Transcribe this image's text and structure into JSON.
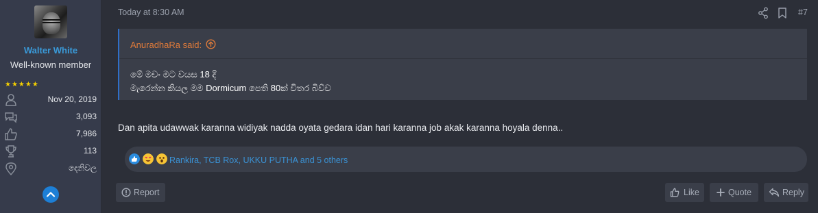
{
  "author": {
    "name": "Walter White",
    "title": "Well-known member",
    "stars": "★★★★★",
    "joined": "Nov 20, 2019",
    "messages": "3,093",
    "reaction_score": "7,986",
    "points": "113",
    "location": "දෙනිවල"
  },
  "post": {
    "date": "Today at 8:30 AM",
    "number": "#7",
    "quote": {
      "author": "AnuradhaRa said:",
      "lines": [
        "මේ මචං මට වයස 18 දි",
        "මැරෙන්න කියල මම Dormicum පෙති 80ක් විතර බිව්ව"
      ]
    },
    "message": "Dan apita udawwak karanna widiyak nadda oyata gedara idan hari karanna job akak karanna hoyala denna..",
    "reactions_text": "Rankira, TCB Rox, UKKU PUTHA and 5 others"
  },
  "actions": {
    "report": "Report",
    "like": "Like",
    "quote": "Quote",
    "reply": "Reply"
  },
  "colors": {
    "accent": "#3a9ad9",
    "quote_author": "#e07b3a",
    "stars": "#f5d000"
  },
  "icons": {
    "joined": "user-icon",
    "messages": "messages-icon",
    "reaction_score": "thumbs-up-icon",
    "points": "trophy-icon",
    "location": "map-pin-icon",
    "scroll_up": "chevron-up-icon",
    "share": "share-icon",
    "bookmark": "bookmark-icon"
  }
}
